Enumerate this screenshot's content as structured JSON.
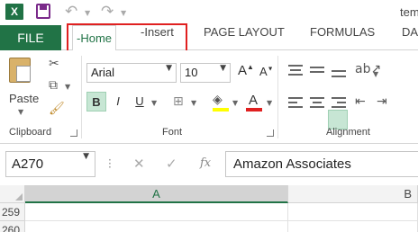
{
  "app": {
    "logo_letter": "X",
    "window_title": "tem",
    "accent_color": "#217346"
  },
  "qat": {
    "icons": [
      "excel-logo",
      "save-icon",
      "undo-icon",
      "redo-icon"
    ]
  },
  "tabs": {
    "file": "FILE",
    "home": "-Home",
    "insert": "-Insert",
    "page_layout": "PAGE LAYOUT",
    "formulas": "FORMULAS",
    "data": "DA"
  },
  "ribbon": {
    "clipboard": {
      "paste_label": "Paste",
      "group_label": "Clipboard"
    },
    "font": {
      "font_name": "Arial",
      "font_size": "10",
      "bold": "B",
      "italic": "I",
      "underline": "U",
      "grow": "A",
      "shrink": "A",
      "font_color_glyph": "A",
      "group_label": "Font",
      "highlight_color": "#ffff00",
      "font_color": "#e02020"
    },
    "alignment": {
      "group_label": "Alignment"
    }
  },
  "formula_bar": {
    "name_box": "A270",
    "fx_label": "fx",
    "formula": "Amazon Associates"
  },
  "grid": {
    "columns": [
      "A",
      "B"
    ],
    "rows": [
      "259",
      "260"
    ]
  }
}
